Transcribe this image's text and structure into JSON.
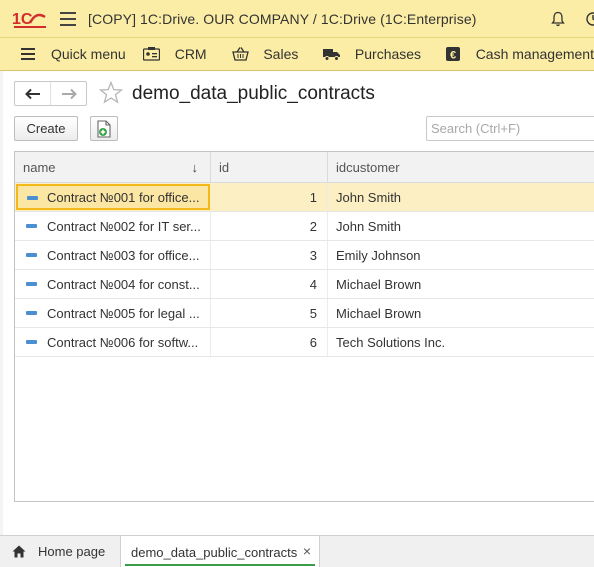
{
  "app": {
    "title": "[COPY] 1C:Drive. OUR COMPANY / 1C:Drive  (1C:Enterprise)",
    "logo_icon": "1c-logo-icon",
    "brand_color": "#d42c2c",
    "bar_color": "#fbeda5"
  },
  "sections": [
    {
      "label": "Quick menu",
      "icon": "list-icon"
    },
    {
      "label": "CRM",
      "icon": "contact-card-icon"
    },
    {
      "label": "Sales",
      "icon": "basket-icon"
    },
    {
      "label": "Purchases",
      "icon": "truck-icon"
    },
    {
      "label": "Cash management",
      "icon": "euro-icon"
    }
  ],
  "form": {
    "title": "demo_data_public_contracts",
    "create_label": "Create",
    "search_placeholder": "Search (Ctrl+F)"
  },
  "table": {
    "columns": {
      "name": "name",
      "id": "id",
      "idcustomer": "idcustomer"
    },
    "sort_indicator": "↓",
    "rows": [
      {
        "name": "Contract №001 for office...",
        "id": "1",
        "idcustomer": "John Smith"
      },
      {
        "name": "Contract №002 for IT ser...",
        "id": "2",
        "idcustomer": "John Smith"
      },
      {
        "name": "Contract №003 for office...",
        "id": "3",
        "idcustomer": "Emily Johnson"
      },
      {
        "name": "Contract №004 for const...",
        "id": "4",
        "idcustomer": "Michael Brown"
      },
      {
        "name": "Contract №005 for legal ...",
        "id": "5",
        "idcustomer": "Michael Brown"
      },
      {
        "name": "Contract №006 for softw...",
        "id": "6",
        "idcustomer": "Tech Solutions Inc."
      }
    ],
    "selected_row": 1
  },
  "tabs": {
    "home": "Home page",
    "active": "demo_data_public_contracts",
    "close_glyph": "×"
  }
}
